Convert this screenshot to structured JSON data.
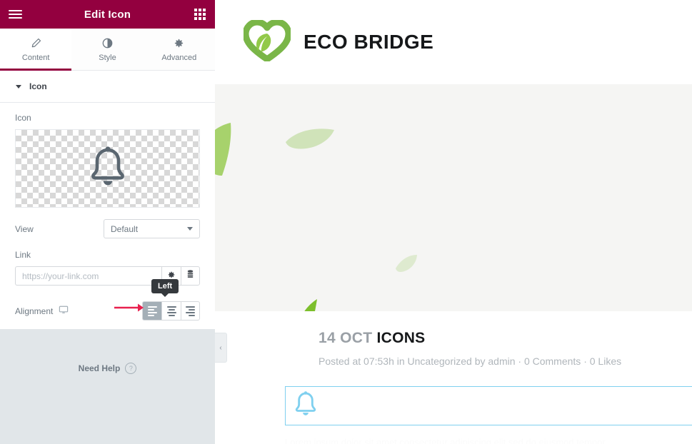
{
  "panel": {
    "header": {
      "title": "Edit Icon",
      "menu_icon": "hamburger-menu-icon",
      "apps_icon": "widgets-grid-icon"
    },
    "tabs": [
      {
        "label": "Content",
        "icon": "pencil-icon",
        "active": true
      },
      {
        "label": "Style",
        "icon": "contrast-circle-icon",
        "active": false
      },
      {
        "label": "Advanced",
        "icon": "gear-icon",
        "active": false
      }
    ],
    "section": {
      "title": "Icon",
      "caret": "caret-down-icon"
    },
    "controls": {
      "icon_label": "Icon",
      "icon_preview_glyph": "bell-icon",
      "view_label": "View",
      "view_value": "Default",
      "link_label": "Link",
      "link_value": "",
      "link_placeholder": "https://your-link.com",
      "link_settings_icon": "gear-icon",
      "link_dynamic_icon": "dynamic-tags-icon",
      "alignment_label": "Alignment",
      "alignment_device_icon": "desktop-monitor-icon",
      "alignment_options": [
        "Left",
        "Center",
        "Right"
      ],
      "alignment_selected": "Left",
      "alignment_tooltip": "Left"
    },
    "footer": {
      "need_help_label": "Need Help",
      "help_icon": "question-mark-icon"
    },
    "collapse_handle_icon": "chevron-left-icon"
  },
  "preview": {
    "brand": {
      "name": "ECO BRIDGE",
      "logo_icon": "eco-heart-leaf-logo"
    },
    "post": {
      "date": "14 OCT",
      "title": "ICONS",
      "meta": "Posted at 07:53h in Uncategorized by admin · 0 Comments · 0 Likes"
    },
    "widget": {
      "icon": "bell-icon",
      "selected": true
    },
    "faint_text": "Lorem ipsum dolor sit amet consectetur adipiscing elit sed do eiusmod tempor"
  },
  "colors": {
    "panel_header_bg": "#93003f",
    "accent": "#93003f",
    "annotation_arrow": "#e8204e",
    "widget_outline": "#7fd0ef",
    "widget_icon": "#7fd0ef",
    "brand_green": "#7ab648",
    "banner_bg": "#f5f5f3",
    "panel_footer_bg": "#e1e6e9",
    "tooltip_bg": "#35393d"
  }
}
